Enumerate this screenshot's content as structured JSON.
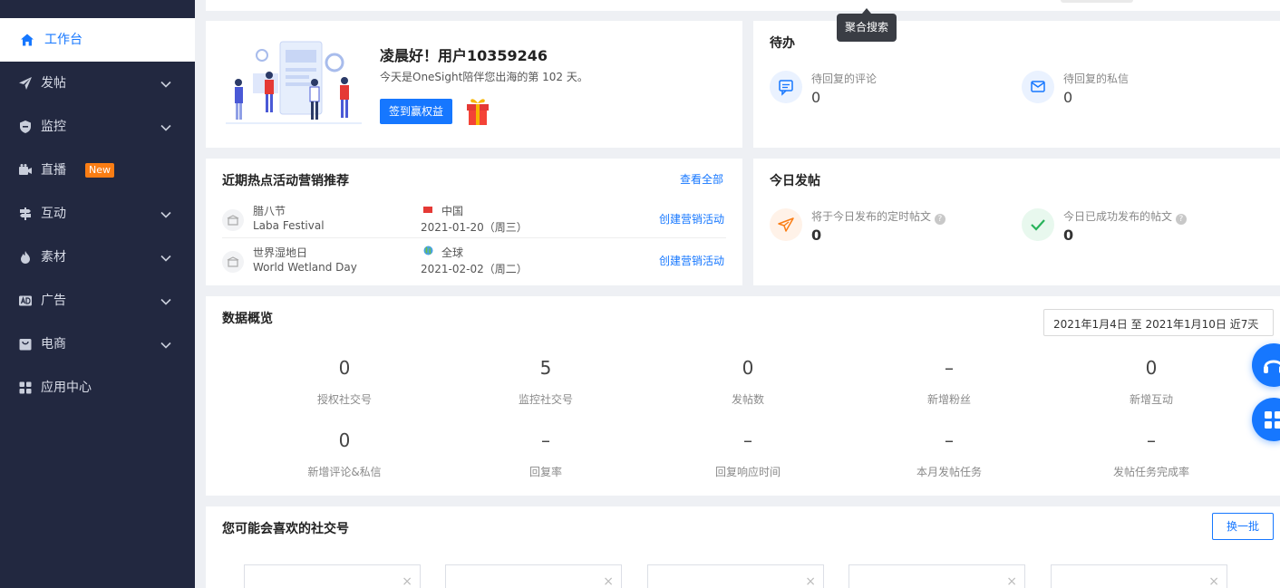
{
  "sidebar": {
    "items": [
      {
        "label": "工作台"
      },
      {
        "label": "发帖"
      },
      {
        "label": "监控"
      },
      {
        "label": "直播",
        "badge": "New"
      },
      {
        "label": "互动"
      },
      {
        "label": "素材"
      },
      {
        "label": "广告"
      },
      {
        "label": "电商"
      },
      {
        "label": "应用中心"
      }
    ]
  },
  "tooltip": "聚合搜索",
  "welcome": {
    "greeting": "凌晨好！用户10359246",
    "subtitle": "今天是OneSight陪伴您出海的第 102 天。",
    "signin_button": "签到赢权益"
  },
  "todo": {
    "title": "待办",
    "items": [
      {
        "label": "待回复的评论",
        "value": "0"
      },
      {
        "label": "待回复的私信",
        "value": "0"
      }
    ]
  },
  "events": {
    "title": "近期热点活动营销推荐",
    "view_all": "查看全部",
    "rows": [
      {
        "name_cn": "腊八节",
        "name_en": "Laba Festival",
        "region": "中国",
        "date": "2021-01-20（周三）",
        "action": "创建营销活动"
      },
      {
        "name_cn": "世界湿地日",
        "name_en": "World Wetland Day",
        "region": "全球",
        "date": "2021-02-02（周二）",
        "action": "创建营销活动"
      }
    ]
  },
  "today_posts": {
    "title": "今日发帖",
    "items": [
      {
        "label": "将于今日发布的定时帖文",
        "value": "0"
      },
      {
        "label": "今日已成功发布的帖文",
        "value": "0"
      }
    ]
  },
  "overview": {
    "title": "数据概览",
    "date_range": "2021年1月4日 至 2021年1月10日 近7天",
    "stats": [
      {
        "value": "0",
        "label": "授权社交号"
      },
      {
        "value": "5",
        "label": "监控社交号"
      },
      {
        "value": "0",
        "label": "发帖数"
      },
      {
        "value": "–",
        "label": "新增粉丝"
      },
      {
        "value": "0",
        "label": "新增互动"
      },
      {
        "value": "0",
        "label": "新增评论&私信"
      },
      {
        "value": "–",
        "label": "回复率"
      },
      {
        "value": "–",
        "label": "回复响应时间"
      },
      {
        "value": "–",
        "label": "本月发帖任务"
      },
      {
        "value": "–",
        "label": "发帖任务完成率"
      }
    ]
  },
  "suggestions": {
    "title": "您可能会喜欢的社交号",
    "refresh_button": "换一批",
    "close_glyph": "×"
  },
  "colors": {
    "sidebar_bg": "#222840",
    "accent": "#1677ff",
    "badge": "#fa7d14"
  }
}
